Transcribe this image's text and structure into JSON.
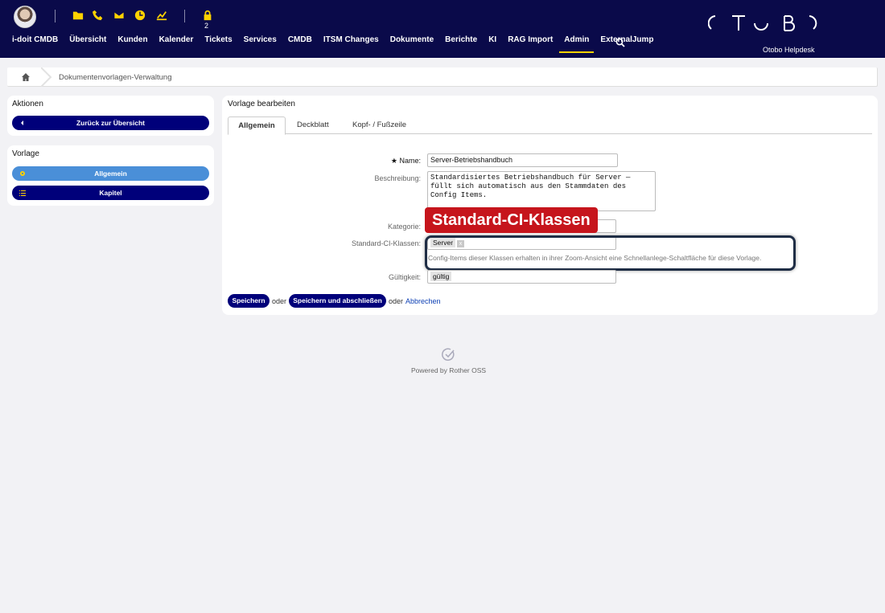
{
  "header": {
    "lock_count": "2",
    "nav": [
      "i-doit CMDB",
      "Übersicht",
      "Kunden",
      "Kalender",
      "Tickets",
      "Services",
      "CMDB",
      "ITSM Changes",
      "Dokumente",
      "Berichte",
      "KI",
      "RAG Import",
      "Admin",
      "ExternalJump"
    ],
    "active_nav": "Admin",
    "logo_subtitle": "Otobo Helpdesk",
    "accent_color": "#ffd200",
    "background_color": "#0a0a4a"
  },
  "breadcrumb": {
    "current": "Dokumentenvorlagen-Verwaltung"
  },
  "sidebar": {
    "actions_title": "Aktionen",
    "back_button": "Zurück zur Übersicht",
    "template_title": "Vorlage",
    "items": [
      {
        "label": "Allgemein",
        "icon": "gear-icon",
        "active": true
      },
      {
        "label": "Kapitel",
        "icon": "list-icon",
        "active": false
      }
    ]
  },
  "main": {
    "title": "Vorlage bearbeiten",
    "tabs": [
      "Allgemein",
      "Deckblatt",
      "Kopf- / Fußzeile"
    ],
    "active_tab": "Allgemein",
    "form": {
      "name_label": "Name:",
      "name_value": "Server-Betriebshandbuch",
      "description_label": "Beschreibung:",
      "description_value": "Standardisiertes Betriebshandbuch für Server — füllt sich automatisch aus den Stammdaten des Config Items.",
      "category_label": "Kategorie:",
      "category_value": "",
      "ci_classes_label": "Standard-CI-Klassen:",
      "ci_classes": [
        "Server"
      ],
      "ci_classes_hint": "Config-Items dieser Klassen erhalten in ihrer Zoom-Ansicht eine Schnellanlege-Schaltfläche für diese Vorlage.",
      "validity_label": "Gültigkeit:",
      "validity_value": "gültig"
    },
    "actions": {
      "save": "Speichern",
      "or1": "oder",
      "save_close": "Speichern und abschließen",
      "or2": "oder",
      "cancel": "Abbrechen"
    },
    "callout": "Standard-CI-Klassen",
    "callout_color": "#c6151c"
  },
  "footer": {
    "powered_by": "Powered by Rother OSS"
  }
}
